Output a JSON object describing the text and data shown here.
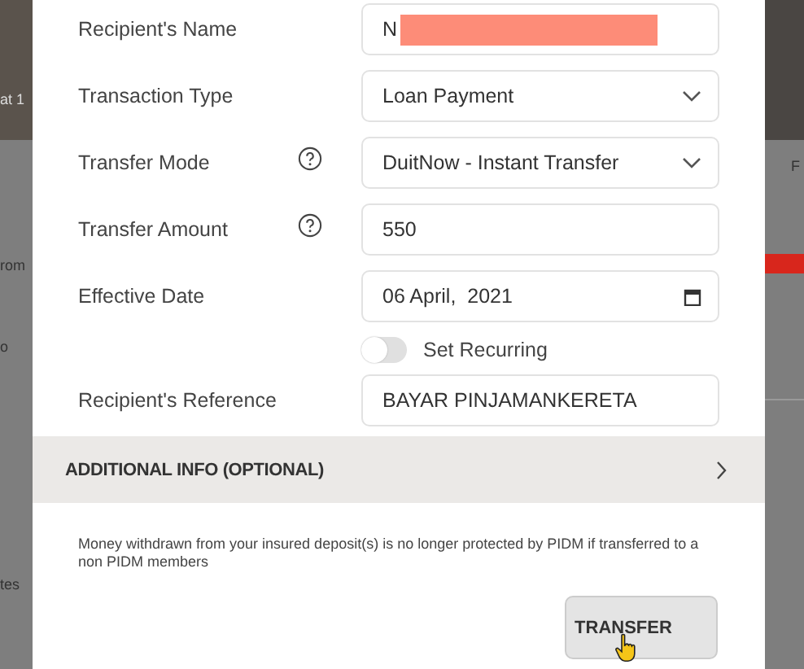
{
  "background": {
    "left_texts": [
      "at 1",
      "rom",
      "o",
      "tes"
    ],
    "right_texts": [
      "F"
    ]
  },
  "form": {
    "fields": [
      {
        "label": "Recipient's Name",
        "kind": "text",
        "value": "N",
        "help": false,
        "redacted": true
      },
      {
        "label": "Transaction Type",
        "kind": "select",
        "value": "Loan Payment",
        "help": false,
        "redacted": false
      },
      {
        "label": "Transfer Mode",
        "kind": "select",
        "value": "DuitNow - Instant Transfer",
        "help": true,
        "redacted": false
      },
      {
        "label": "Transfer Amount",
        "kind": "text",
        "value": "550",
        "help": true,
        "redacted": false
      },
      {
        "label": "Effective Date",
        "kind": "date",
        "value": "06 April,  2021",
        "help": false,
        "redacted": false
      },
      {
        "label": "Set Recurring",
        "kind": "toggle",
        "on": false
      },
      {
        "label": "Recipient's Reference",
        "kind": "text",
        "value": "BAYAR PINJAMANKERETA",
        "help": false,
        "redacted": false
      }
    ]
  },
  "additional_info": {
    "label": "ADDITIONAL INFO (OPTIONAL)",
    "expanded": false
  },
  "disclaimer": "Money withdrawn from your insured deposit(s) is no longer protected by PIDM if transferred to a non PIDM members",
  "button": {
    "label": "TRANSFER"
  }
}
